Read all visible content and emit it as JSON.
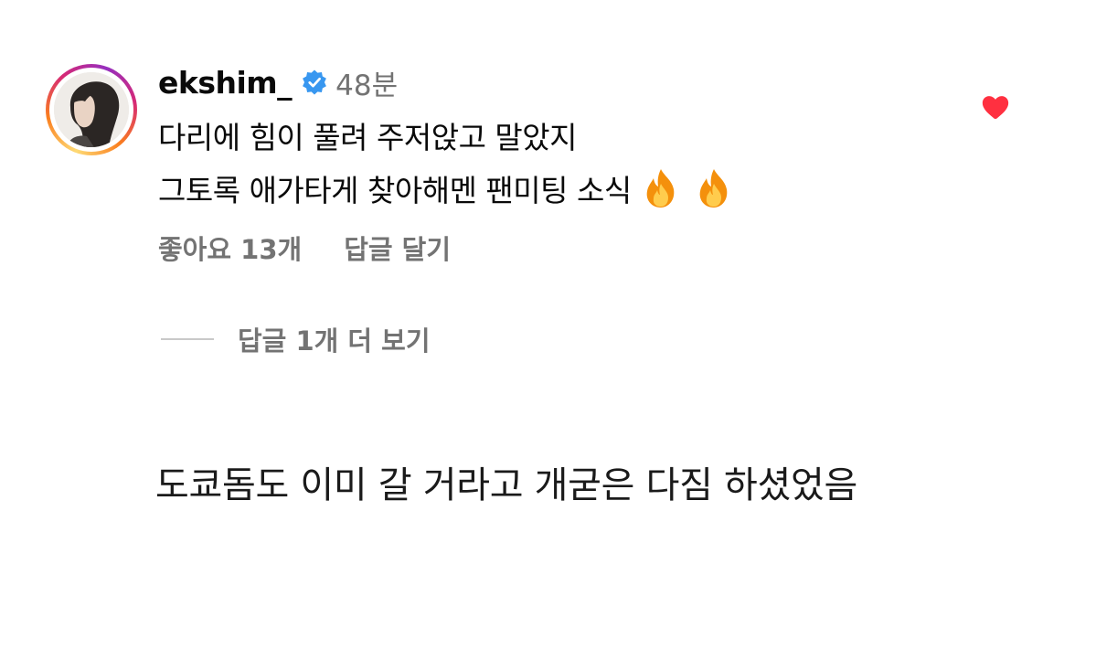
{
  "comment": {
    "username": "ekshim_",
    "time": "48분",
    "text_lines": [
      "다리에 힘이 풀려 주저앉고 말았지",
      "그토록 애가타게 찾아해멘 팬미팅 소식"
    ],
    "emojis": [
      "fire-emoji",
      "fire-emoji"
    ],
    "likes_label": "좋아요 13개",
    "reply_label": "답글 달기",
    "liked": true,
    "heart_color": "#ff3040",
    "verified_color": "#3897f0"
  },
  "replies": {
    "view_more_label": "답글 1개 더 보기"
  },
  "caption": {
    "text": "도쿄돔도 이미 갈 거라고 개굳은 다짐 하셨었음"
  }
}
